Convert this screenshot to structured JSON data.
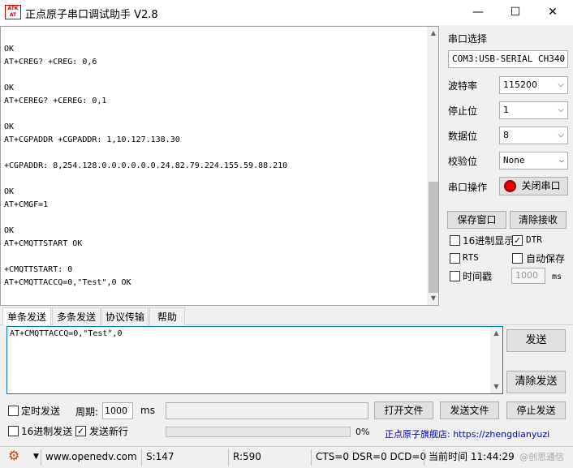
{
  "window": {
    "logo_text": "ATK\nALIENTEK",
    "title": "正点原子串口调试助手 V2.8",
    "minimize": "—",
    "maximize": "☐",
    "close": "✕"
  },
  "terminal": {
    "lines": [
      "OK",
      "AT+CREG? +CREG: 0,6",
      "",
      "OK",
      "AT+CEREG? +CEREG: 0,1",
      "",
      "OK",
      "AT+CGPADDR +CGPADDR: 1,10.127.138.30",
      "",
      "+CGPADDR: 8,254.128.0.0.0.0.0.0.24.82.79.224.155.59.88.210",
      "",
      "OK",
      "AT+CMGF=1",
      "",
      "OK",
      "AT+CMQTTSTART OK",
      "",
      "+CMQTTSTART: 0",
      "AT+CMQTTACCQ=0,\"Test\",0 OK"
    ]
  },
  "serial": {
    "port_label": "串口选择",
    "port_value": "COM3:USB-SERIAL CH340",
    "baud_label": "波特率",
    "baud_value": "115200",
    "stopbit_label": "停止位",
    "stopbit_value": "1",
    "databit_label": "数据位",
    "databit_value": "8",
    "parity_label": "校验位",
    "parity_value": "None",
    "op_label": "串口操作",
    "op_button": "关闭串口",
    "save_window": "保存窗口",
    "clear_receive": "清除接收",
    "hex_display": "16进制显示",
    "dtr": "DTR",
    "rts": "RTS",
    "auto_save": "自动保存",
    "timestamp": "时间戳",
    "timestamp_value": "1000",
    "timestamp_unit": "ms"
  },
  "tabs": [
    "单条发送",
    "多条发送",
    "协议传输",
    "帮助"
  ],
  "send": {
    "text": "AT+CMQTTACCQ=0,\"Test\",0",
    "send_button": "发送",
    "clear_send_button": "清除发送",
    "timed_send": "定时发送",
    "period_label": "周期:",
    "period_value": "1000",
    "period_unit": "ms",
    "open_file": "打开文件",
    "send_file": "发送文件",
    "stop_send": "停止发送",
    "hex_send": "16进制发送",
    "send_newline": "发送新行",
    "progress": "0%",
    "progress_value": 0,
    "promo": "正点原子旗舰店: https://zhengdianyuzi"
  },
  "status": {
    "url": "www.openedv.com",
    "sent": "S:147",
    "received": "R:590",
    "lines": "CTS=0 DSR=0 DCD=0",
    "time": "当前时间 11:44:29",
    "watermark": "@创思通信"
  }
}
